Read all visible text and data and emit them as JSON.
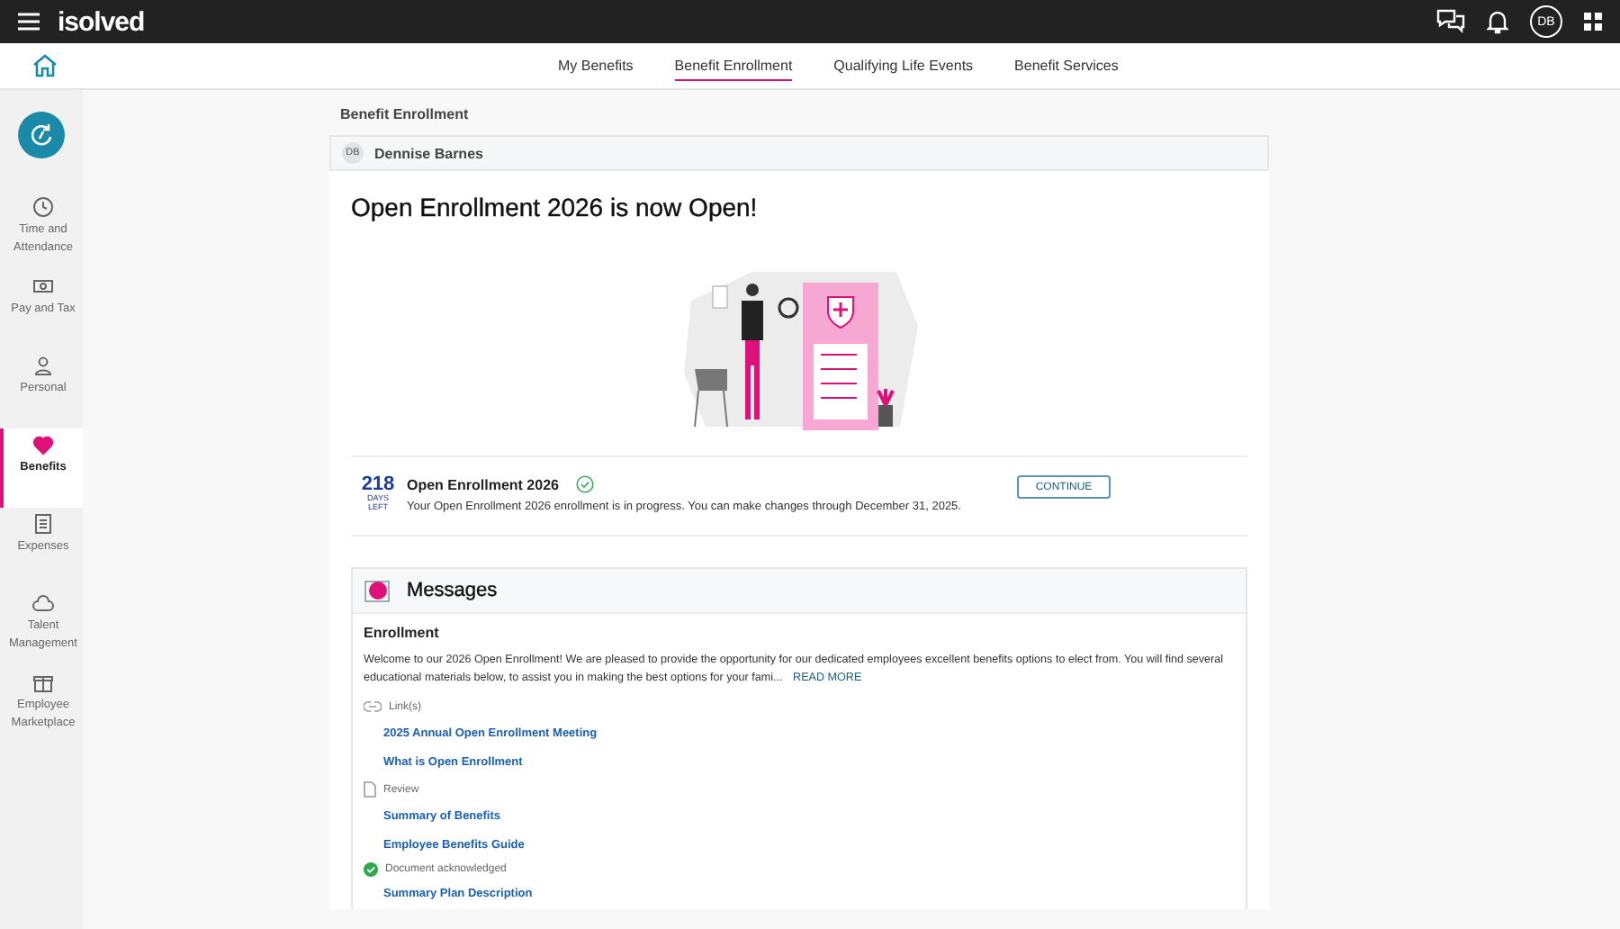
{
  "topbar": {
    "logo": "isolved",
    "avatar": "DB"
  },
  "nav_tabs": [
    {
      "label": "My Benefits",
      "selected": false
    },
    {
      "label": "Benefit Enrollment",
      "selected": true
    },
    {
      "label": "Qualifying Life Events",
      "selected": false
    },
    {
      "label": "Benefit Services",
      "selected": false
    }
  ],
  "sidebar": {
    "items": [
      {
        "label": "Time and Attendance",
        "selected": false
      },
      {
        "label": "Pay and Tax",
        "selected": false
      },
      {
        "label": "Personal",
        "selected": false
      },
      {
        "label": "Benefits",
        "selected": true
      },
      {
        "label": "Expenses",
        "selected": false
      },
      {
        "label": "Talent Management",
        "selected": false
      },
      {
        "label": "Employee Marketplace",
        "selected": false
      }
    ]
  },
  "breadcrumb": "Benefit Enrollment",
  "employee": {
    "initials": "DB",
    "name": "Dennise Barnes"
  },
  "headline": "Open Enrollment 2026 is now Open!",
  "enrollment": {
    "days": "218",
    "days_label": "DAYS",
    "left_label": "LEFT",
    "title": "Open Enrollment 2026",
    "message": "Your Open Enrollment 2026 enrollment is in progress. You can make changes through December 31, 2025.",
    "button": "CONTINUE"
  },
  "messages": {
    "title": "Messages",
    "heading": "Enrollment",
    "body": "Welcome to our 2026 Open Enrollment! We are pleased to provide the opportunity for our dedicated employees excellent benefits options to elect from. You will find several educational materials below, to assist you in making the best options for your fami...",
    "read_more": "READ MORE",
    "items": [
      {
        "kind": "links-section",
        "text": "Link(s)"
      },
      {
        "kind": "link",
        "text": "2025 Annual Open Enrollment Meeting"
      },
      {
        "kind": "link",
        "text": "What is Open Enrollment"
      },
      {
        "kind": "review-section",
        "text": "Review"
      },
      {
        "kind": "link",
        "text": "Summary of Benefits"
      },
      {
        "kind": "link",
        "text": "Employee Benefits Guide"
      },
      {
        "kind": "status",
        "text": "Document acknowledged"
      },
      {
        "kind": "link",
        "text": "Summary Plan Description"
      }
    ]
  }
}
